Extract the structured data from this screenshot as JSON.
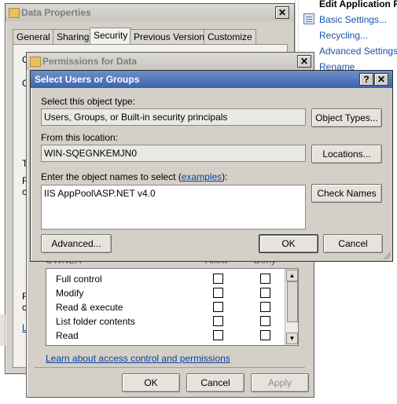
{
  "actions_pane": {
    "title": "Edit Application Po",
    "links": [
      "Basic Settings...",
      "Recycling...",
      "Advanced Settings...",
      "Rename"
    ]
  },
  "data_properties": {
    "title": "Data Properties",
    "close": "✕",
    "tabs": [
      "General",
      "Sharing",
      "Security",
      "Previous Versions",
      "Customize"
    ],
    "selected_tab": "Security",
    "edge_labels": [
      "C",
      "G",
      "T",
      "F",
      "c",
      "F",
      "c",
      "L"
    ]
  },
  "permissions": {
    "title": "Permissions for Data",
    "close": "✕",
    "owner_header_partial": "OWNER",
    "allow_header": "Allow",
    "deny_header": "Deny",
    "rows": [
      {
        "name": "Full control",
        "allow": false,
        "deny": false
      },
      {
        "name": "Modify",
        "allow": false,
        "deny": false
      },
      {
        "name": "Read & execute",
        "allow": false,
        "deny": false
      },
      {
        "name": "List folder contents",
        "allow": false,
        "deny": false
      },
      {
        "name": "Read",
        "allow": false,
        "deny": false
      }
    ],
    "learn_link": "Learn about access control and permissions",
    "ok": "OK",
    "cancel": "Cancel",
    "apply": "Apply"
  },
  "select_users": {
    "title": "Select Users or Groups",
    "help": "?",
    "close": "✕",
    "object_type_label": "Select this object type:",
    "object_type_value": "Users, Groups, or Built-in security principals",
    "object_types_button": "Object Types...",
    "location_label": "From this location:",
    "location_value": "WIN-SQEGNKEMJN0",
    "locations_button": "Locations...",
    "names_label_prefix": "Enter the object names to select (",
    "names_label_link": "examples",
    "names_label_suffix": "):",
    "names_value": "IIS AppPool\\ASP.NET v4.0",
    "check_names_button": "Check Names",
    "advanced_button": "Advanced...",
    "ok": "OK",
    "cancel": "Cancel"
  },
  "colors": {
    "active_title": "#3c63ad",
    "inactive_title": "#c9c6bf",
    "dialog_face": "#d4d0c8",
    "link": "#0b3f9e"
  }
}
